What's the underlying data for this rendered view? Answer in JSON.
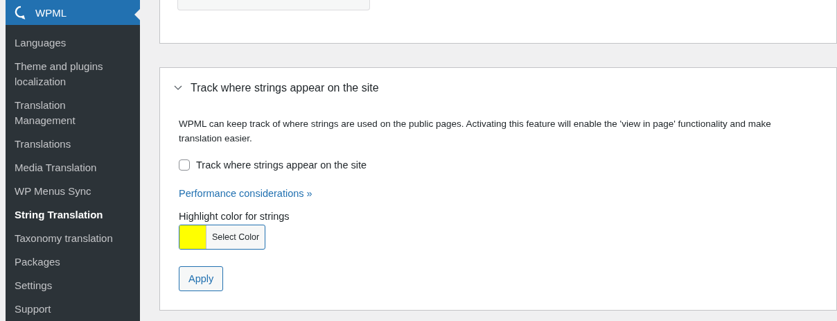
{
  "sidebar": {
    "header": {
      "label": "WPML"
    },
    "items": [
      {
        "label": "Languages",
        "selected": false
      },
      {
        "label": "Theme and plugins localization",
        "selected": false
      },
      {
        "label": "Translation Management",
        "selected": false
      },
      {
        "label": "Translations",
        "selected": false
      },
      {
        "label": "Media Translation",
        "selected": false
      },
      {
        "label": "WP Menus Sync",
        "selected": false
      },
      {
        "label": "String Translation",
        "selected": true
      },
      {
        "label": "Taxonomy translation",
        "selected": false
      },
      {
        "label": "Packages",
        "selected": false
      },
      {
        "label": "Settings",
        "selected": false
      },
      {
        "label": "Support",
        "selected": false
      }
    ]
  },
  "panel": {
    "title": "Track where strings appear on the site",
    "expanded": true,
    "description": "WPML can keep track of where strings are used on the public pages. Activating this feature will enable the 'view in page' functionality and make translation easier.",
    "checkbox": {
      "label": "Track where strings appear on the site",
      "checked": false
    },
    "link": "Performance considerations »",
    "color_label": "Highlight color for strings",
    "color_picker": {
      "color": "#ffff00",
      "label": "Select Color"
    },
    "button": "Apply"
  }
}
